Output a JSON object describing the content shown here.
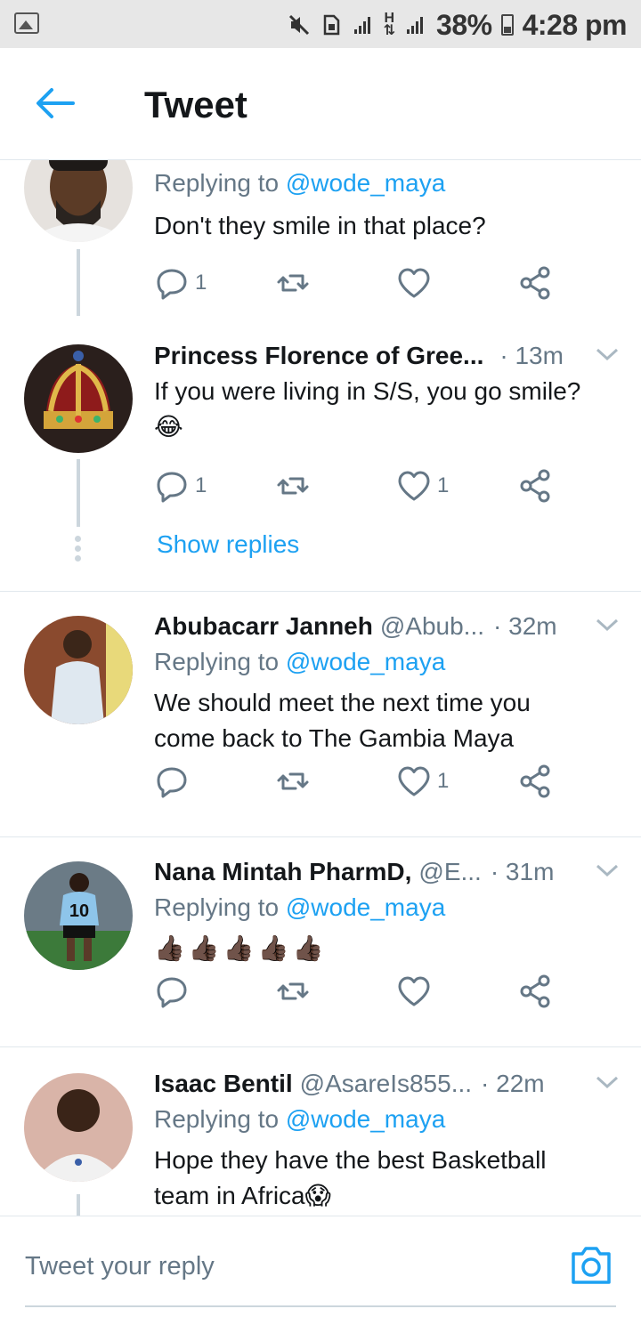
{
  "status_bar": {
    "battery": "38%",
    "time": "4:28 pm",
    "network_label": "H"
  },
  "header": {
    "title": "Tweet"
  },
  "tweets": [
    {
      "name": "",
      "handle": "",
      "time": "",
      "replying_prefix": "Replying to ",
      "replying_mention": "@wode_maya",
      "text": "Don't they smile in that place?",
      "reply_count": "1",
      "retweet_count": "",
      "like_count": ""
    },
    {
      "name": "Princess Florence of Gree...",
      "handle": "",
      "time": "· 13m",
      "text": "If you were living in S/S, you go smile?",
      "emoji": "😂",
      "reply_count": "1",
      "retweet_count": "",
      "like_count": "1"
    },
    {
      "name": "Abubacarr Janneh",
      "handle": "@Abub...",
      "time": "· 32m",
      "replying_prefix": "Replying to ",
      "replying_mention": "@wode_maya",
      "text": "We should meet the next time you come back to The Gambia Maya",
      "reply_count": "",
      "retweet_count": "",
      "like_count": "1"
    },
    {
      "name": "Nana Mintah PharmD,",
      "handle": "@E...",
      "time": "· 31m",
      "replying_prefix": "Replying to ",
      "replying_mention": "@wode_maya",
      "text": "👍🏿👍🏿👍🏿👍🏿👍🏿",
      "reply_count": "",
      "retweet_count": "",
      "like_count": ""
    },
    {
      "name": "Isaac Bentil",
      "handle": "@AsareIs855...",
      "time": "· 22m",
      "replying_prefix": "Replying to ",
      "replying_mention": "@wode_maya",
      "text": "Hope they have the best Basketball team in Africa😱"
    }
  ],
  "show_replies": "Show replies",
  "composer": {
    "placeholder": "Tweet your reply"
  },
  "colors": {
    "accent": "#1da1f2",
    "secondary_text": "#657786",
    "divider": "#e1e8ed"
  }
}
